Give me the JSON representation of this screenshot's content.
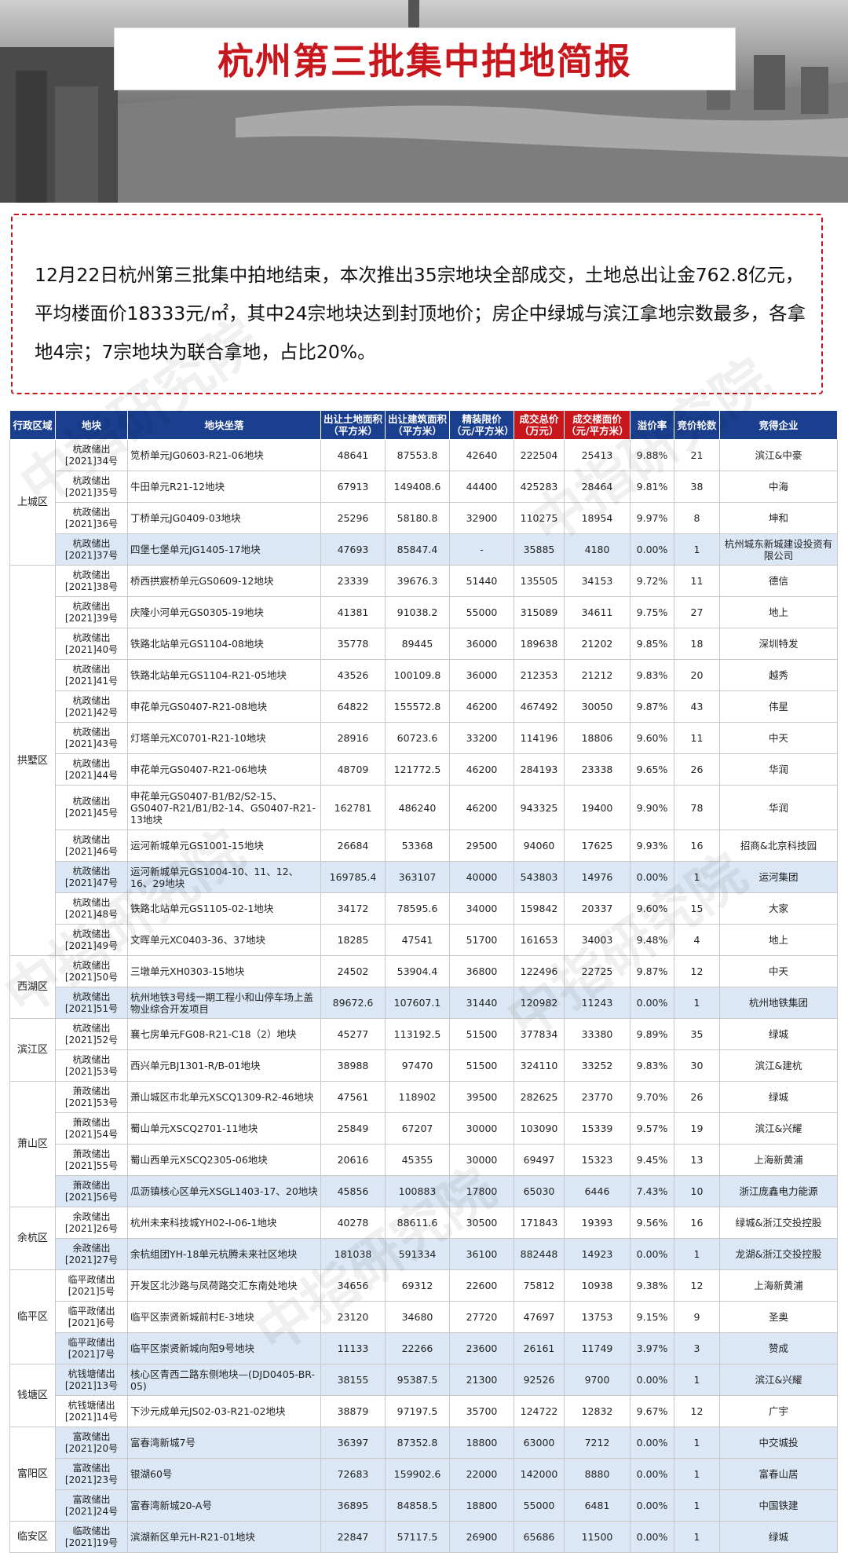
{
  "title": "杭州第三批集中拍地简报",
  "summary": "12月22日杭州第三批集中拍地结束，本次推出35宗地块全部成交，土地总出让金762.8亿元，平均楼面价18333元/㎡，其中24宗地块达到封顶地价；房企中绿城与滨江拿地宗数最多，各拿地4宗；7宗地块为联合拿地，占比20%。",
  "watermark": "中指研究院",
  "headers": [
    "行政区域",
    "地块",
    "地块坐落",
    "出让土地面积（平方米）",
    "出让建筑面积（平方米）",
    "精装限价（元/平方米）",
    "成交总价（万元）",
    "成交楼面价（元/平方米）",
    "溢价率",
    "竞价轮数",
    "竞得企业"
  ],
  "regions": [
    {
      "name": "上城区",
      "start": 0,
      "span": 4
    },
    {
      "name": "拱墅区",
      "start": 4,
      "span": 12
    },
    {
      "name": "西湖区",
      "start": 16,
      "span": 2
    },
    {
      "name": "滨江区",
      "start": 18,
      "span": 2
    },
    {
      "name": "萧山区",
      "start": 20,
      "span": 4
    },
    {
      "name": "余杭区",
      "start": 24,
      "span": 2
    },
    {
      "name": "临平区",
      "start": 26,
      "span": 3
    },
    {
      "name": "钱塘区",
      "start": 29,
      "span": 2
    },
    {
      "name": "富阳区",
      "start": 31,
      "span": 3
    },
    {
      "name": "临安区",
      "start": 34,
      "span": 1
    }
  ],
  "rows": [
    {
      "lot": "杭政储出[2021]34号",
      "loc": "笕桥单元JG0603-R21-06地块",
      "land": "48641",
      "build": "87553.8",
      "cap": "42640",
      "total": "222504",
      "floor": "25413",
      "premium": "9.88%",
      "rounds": "21",
      "winner": "滨江&中豪",
      "hl": false
    },
    {
      "lot": "杭政储出[2021]35号",
      "loc": "牛田单元R21-12地块",
      "land": "67913",
      "build": "149408.6",
      "cap": "44400",
      "total": "425283",
      "floor": "28464",
      "premium": "9.81%",
      "rounds": "38",
      "winner": "中海",
      "hl": false
    },
    {
      "lot": "杭政储出[2021]36号",
      "loc": "丁桥单元JG0409-03地块",
      "land": "25296",
      "build": "58180.8",
      "cap": "32900",
      "total": "110275",
      "floor": "18954",
      "premium": "9.97%",
      "rounds": "8",
      "winner": "坤和",
      "hl": false
    },
    {
      "lot": "杭政储出[2021]37号",
      "loc": "四堡七堡单元JG1405-17地块",
      "land": "47693",
      "build": "85847.4",
      "cap": "-",
      "total": "35885",
      "floor": "4180",
      "premium": "0.00%",
      "rounds": "1",
      "winner": "杭州城东新城建设投资有限公司",
      "hl": true
    },
    {
      "lot": "杭政储出[2021]38号",
      "loc": "桥西拱宸桥单元GS0609-12地块",
      "land": "23339",
      "build": "39676.3",
      "cap": "51440",
      "total": "135505",
      "floor": "34153",
      "premium": "9.72%",
      "rounds": "11",
      "winner": "德信",
      "hl": false
    },
    {
      "lot": "杭政储出[2021]39号",
      "loc": "庆隆小河单元GS0305-19地块",
      "land": "41381",
      "build": "91038.2",
      "cap": "55000",
      "total": "315089",
      "floor": "34611",
      "premium": "9.75%",
      "rounds": "27",
      "winner": "地上",
      "hl": false
    },
    {
      "lot": "杭政储出[2021]40号",
      "loc": "铁路北站单元GS1104-08地块",
      "land": "35778",
      "build": "89445",
      "cap": "36000",
      "total": "189638",
      "floor": "21202",
      "premium": "9.85%",
      "rounds": "18",
      "winner": "深圳特发",
      "hl": false
    },
    {
      "lot": "杭政储出[2021]41号",
      "loc": "铁路北站单元GS1104-R21-05地块",
      "land": "43526",
      "build": "100109.8",
      "cap": "36000",
      "total": "212353",
      "floor": "21212",
      "premium": "9.83%",
      "rounds": "20",
      "winner": "越秀",
      "hl": false
    },
    {
      "lot": "杭政储出[2021]42号",
      "loc": "申花单元GS0407-R21-08地块",
      "land": "64822",
      "build": "155572.8",
      "cap": "46200",
      "total": "467492",
      "floor": "30050",
      "premium": "9.87%",
      "rounds": "43",
      "winner": "伟星",
      "hl": false
    },
    {
      "lot": "杭政储出[2021]43号",
      "loc": "灯塔单元XC0701-R21-10地块",
      "land": "28916",
      "build": "60723.6",
      "cap": "33200",
      "total": "114196",
      "floor": "18806",
      "premium": "9.60%",
      "rounds": "11",
      "winner": "中天",
      "hl": false
    },
    {
      "lot": "杭政储出[2021]44号",
      "loc": "申花单元GS0407-R21-06地块",
      "land": "48709",
      "build": "121772.5",
      "cap": "46200",
      "total": "284193",
      "floor": "23338",
      "premium": "9.65%",
      "rounds": "26",
      "winner": "华润",
      "hl": false
    },
    {
      "lot": "杭政储出[2021]45号",
      "loc": "申花单元GS0407-B1/B2/S2-15、GS0407-R21/B1/B2-14、GS0407-R21-13地块",
      "land": "162781",
      "build": "486240",
      "cap": "46200",
      "total": "943325",
      "floor": "19400",
      "premium": "9.90%",
      "rounds": "78",
      "winner": "华润",
      "hl": false,
      "tall": true
    },
    {
      "lot": "杭政储出[2021]46号",
      "loc": "运河新城单元GS1001-15地块",
      "land": "26684",
      "build": "53368",
      "cap": "29500",
      "total": "94060",
      "floor": "17625",
      "premium": "9.93%",
      "rounds": "16",
      "winner": "招商&北京科技园",
      "hl": false
    },
    {
      "lot": "杭政储出[2021]47号",
      "loc": "运河新城单元GS1004-10、11、12、16、29地块",
      "land": "169785.4",
      "build": "363107",
      "cap": "40000",
      "total": "543803",
      "floor": "14976",
      "premium": "0.00%",
      "rounds": "1",
      "winner": "运河集团",
      "hl": true
    },
    {
      "lot": "杭政储出[2021]48号",
      "loc": "铁路北站单元GS1105-02-1地块",
      "land": "34172",
      "build": "78595.6",
      "cap": "34000",
      "total": "159842",
      "floor": "20337",
      "premium": "9.60%",
      "rounds": "15",
      "winner": "大家",
      "hl": false
    },
    {
      "lot": "杭政储出[2021]49号",
      "loc": "文晖单元XC0403-36、37地块",
      "land": "18285",
      "build": "47541",
      "cap": "51700",
      "total": "161653",
      "floor": "34003",
      "premium": "9.48%",
      "rounds": "4",
      "winner": "地上",
      "hl": false
    },
    {
      "lot": "杭政储出[2021]50号",
      "loc": "三墩单元XH0303-15地块",
      "land": "24502",
      "build": "53904.4",
      "cap": "36800",
      "total": "122496",
      "floor": "22725",
      "premium": "9.87%",
      "rounds": "12",
      "winner": "中天",
      "hl": false
    },
    {
      "lot": "杭政储出[2021]51号",
      "loc": "杭州地铁3号线一期工程小和山停车场上盖物业综合开发项目",
      "land": "89672.6",
      "build": "107607.1",
      "cap": "31440",
      "total": "120982",
      "floor": "11243",
      "premium": "0.00%",
      "rounds": "1",
      "winner": "杭州地铁集团",
      "hl": true
    },
    {
      "lot": "杭政储出[2021]52号",
      "loc": "襄七房单元FG08-R21-C18（2）地块",
      "land": "45277",
      "build": "113192.5",
      "cap": "51500",
      "total": "377834",
      "floor": "33380",
      "premium": "9.89%",
      "rounds": "35",
      "winner": "绿城",
      "hl": false
    },
    {
      "lot": "杭政储出[2021]53号",
      "loc": "西兴单元BJ1301-R/B-01地块",
      "land": "38988",
      "build": "97470",
      "cap": "51500",
      "total": "324110",
      "floor": "33252",
      "premium": "9.83%",
      "rounds": "30",
      "winner": "滨江&建杭",
      "hl": false
    },
    {
      "lot": "萧政储出[2021]53号",
      "loc": "萧山城区市北单元XSCQ1309-R2-46地块",
      "land": "47561",
      "build": "118902",
      "cap": "39500",
      "total": "282625",
      "floor": "23770",
      "premium": "9.70%",
      "rounds": "26",
      "winner": "绿城",
      "hl": false
    },
    {
      "lot": "萧政储出[2021]54号",
      "loc": "蜀山单元XSCQ2701-11地块",
      "land": "25849",
      "build": "67207",
      "cap": "30000",
      "total": "103090",
      "floor": "15339",
      "premium": "9.57%",
      "rounds": "19",
      "winner": "滨江&兴耀",
      "hl": false
    },
    {
      "lot": "萧政储出[2021]55号",
      "loc": "蜀山西单元XSCQ2305-06地块",
      "land": "20616",
      "build": "45355",
      "cap": "30000",
      "total": "69497",
      "floor": "15323",
      "premium": "9.45%",
      "rounds": "13",
      "winner": "上海新黄浦",
      "hl": false
    },
    {
      "lot": "萧政储出[2021]56号",
      "loc": "瓜沥镇核心区单元XSGL1403-17、20地块",
      "land": "45856",
      "build": "100883",
      "cap": "17800",
      "total": "65030",
      "floor": "6446",
      "premium": "7.43%",
      "rounds": "10",
      "winner": "浙江庞鑫电力能源",
      "hl": true
    },
    {
      "lot": "余政储出[2021]26号",
      "loc": "杭州未来科技城YH02-I-06-1地块",
      "land": "40278",
      "build": "88611.6",
      "cap": "30500",
      "total": "171843",
      "floor": "19393",
      "premium": "9.56%",
      "rounds": "16",
      "winner": "绿城&浙江交投控股",
      "hl": false
    },
    {
      "lot": "余政储出[2021]27号",
      "loc": "余杭组团YH-18单元杭腾未来社区地块",
      "land": "181038",
      "build": "591334",
      "cap": "36100",
      "total": "882448",
      "floor": "14923",
      "premium": "0.00%",
      "rounds": "1",
      "winner": "龙湖&浙江交投控股",
      "hl": true
    },
    {
      "lot": "临平政储出[2021]5号",
      "loc": "开发区北沙路与凤荷路交汇东南处地块",
      "land": "34656",
      "build": "69312",
      "cap": "22600",
      "total": "75812",
      "floor": "10938",
      "premium": "9.38%",
      "rounds": "12",
      "winner": "上海新黄浦",
      "hl": false
    },
    {
      "lot": "临平政储出[2021]6号",
      "loc": "临平区崇贤新城前村E-3地块",
      "land": "23120",
      "build": "34680",
      "cap": "27720",
      "total": "47697",
      "floor": "13753",
      "premium": "9.15%",
      "rounds": "9",
      "winner": "圣奥",
      "hl": false
    },
    {
      "lot": "临平政储出[2021]7号",
      "loc": "临平区崇贤新城向阳9号地块",
      "land": "11133",
      "build": "22266",
      "cap": "23600",
      "total": "26161",
      "floor": "11749",
      "premium": "3.97%",
      "rounds": "3",
      "winner": "赞成",
      "hl": true
    },
    {
      "lot": "杭钱塘储出[2021]13号",
      "loc": "核心区青西二路东侧地块—(DJD0405-BR-05)",
      "land": "38155",
      "build": "95387.5",
      "cap": "21300",
      "total": "92526",
      "floor": "9700",
      "premium": "0.00%",
      "rounds": "1",
      "winner": "滨江&兴耀",
      "hl": true
    },
    {
      "lot": "杭钱塘储出[2021]14号",
      "loc": "下沙元成单元JS02-03-R21-02地块",
      "land": "38879",
      "build": "97197.5",
      "cap": "35700",
      "total": "124722",
      "floor": "12832",
      "premium": "9.67%",
      "rounds": "12",
      "winner": "广宇",
      "hl": false
    },
    {
      "lot": "富政储出[2021]20号",
      "loc": "富春湾新城7号",
      "land": "36397",
      "build": "87352.8",
      "cap": "18800",
      "total": "63000",
      "floor": "7212",
      "premium": "0.00%",
      "rounds": "1",
      "winner": "中交城投",
      "hl": true
    },
    {
      "lot": "富政储出[2021]23号",
      "loc": "银湖60号",
      "land": "72683",
      "build": "159902.6",
      "cap": "22000",
      "total": "142000",
      "floor": "8880",
      "premium": "0.00%",
      "rounds": "1",
      "winner": "富春山居",
      "hl": true
    },
    {
      "lot": "富政储出[2021]24号",
      "loc": "富春湾新城20-A号",
      "land": "36895",
      "build": "84858.5",
      "cap": "18800",
      "total": "55000",
      "floor": "6481",
      "premium": "0.00%",
      "rounds": "1",
      "winner": "中国铁建",
      "hl": true
    },
    {
      "lot": "临政储出[2021]19号",
      "loc": "滨湖新区单元H-R21-01地块",
      "land": "22847",
      "build": "57117.5",
      "cap": "26900",
      "total": "65686",
      "floor": "11500",
      "premium": "0.00%",
      "rounds": "1",
      "winner": "绿城",
      "hl": true
    }
  ]
}
